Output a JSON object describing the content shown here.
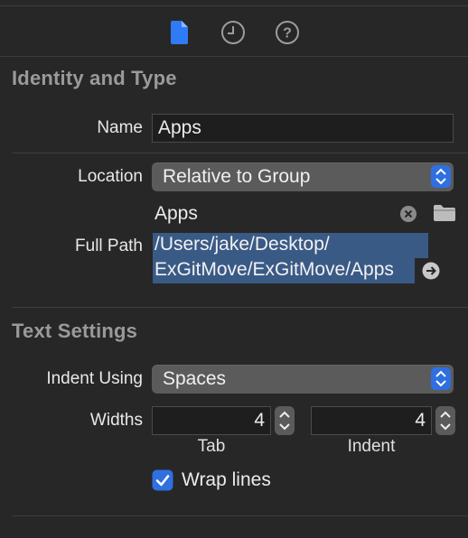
{
  "toolbar": {
    "icons": [
      "file-inspector-icon",
      "history-inspector-icon",
      "help-inspector-icon"
    ]
  },
  "identity": {
    "title": "Identity and Type",
    "name_label": "Name",
    "name_value": "Apps",
    "location_label": "Location",
    "location_value": "Relative to Group",
    "location_file": "Apps",
    "full_path_label": "Full Path",
    "full_path_line1": "/Users/jake/Desktop/",
    "full_path_line2": "ExGitMove/ExGitMove/Apps"
  },
  "text_settings": {
    "title": "Text Settings",
    "indent_using_label": "Indent Using",
    "indent_using_value": "Spaces",
    "widths_label": "Widths",
    "tab_value": "4",
    "tab_label": "Tab",
    "indent_value": "4",
    "indent_label": "Indent",
    "wrap_lines_label": "Wrap lines",
    "wrap_lines_checked": true
  },
  "colors": {
    "background": "#272727",
    "accent": "#2f6fe0",
    "selection": "#3a5a86"
  }
}
